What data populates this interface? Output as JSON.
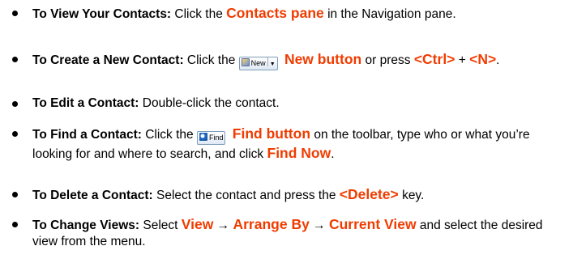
{
  "items": [
    {
      "lead": "To View Your Contacts:",
      "a": "Click the",
      "hl": "Contacts pane",
      "b": "in the Navigation pane."
    },
    {
      "lead": "To Create a New Contact:",
      "a": "Click the",
      "icon_label": "New",
      "icon": "new-contact-icon",
      "hl": "New button",
      "b": "or press",
      "key1": "<Ctrl>",
      "plus": "+",
      "key2": "<N>",
      "end": "."
    },
    {
      "lead": "To Edit a Contact:",
      "a": "Double-click the contact."
    },
    {
      "lead": "To Find a Contact:",
      "a": "Click the",
      "icon_label": "Find",
      "icon": "find-icon",
      "hl": "Find button",
      "b": "on the toolbar, type who or what you’re looking for and where to search, and click",
      "hl2": "Find Now",
      "end": "."
    },
    {
      "lead": "To Delete a Contact:",
      "a": "Select the contact and press the",
      "key": "<Delete>",
      "b": "key."
    },
    {
      "lead": "To Change Views:",
      "a": "Select",
      "m1": "View",
      "arrow": "→",
      "m2": "Arrange By",
      "m3": "Current View",
      "b": "and select the desired view from the menu."
    }
  ]
}
